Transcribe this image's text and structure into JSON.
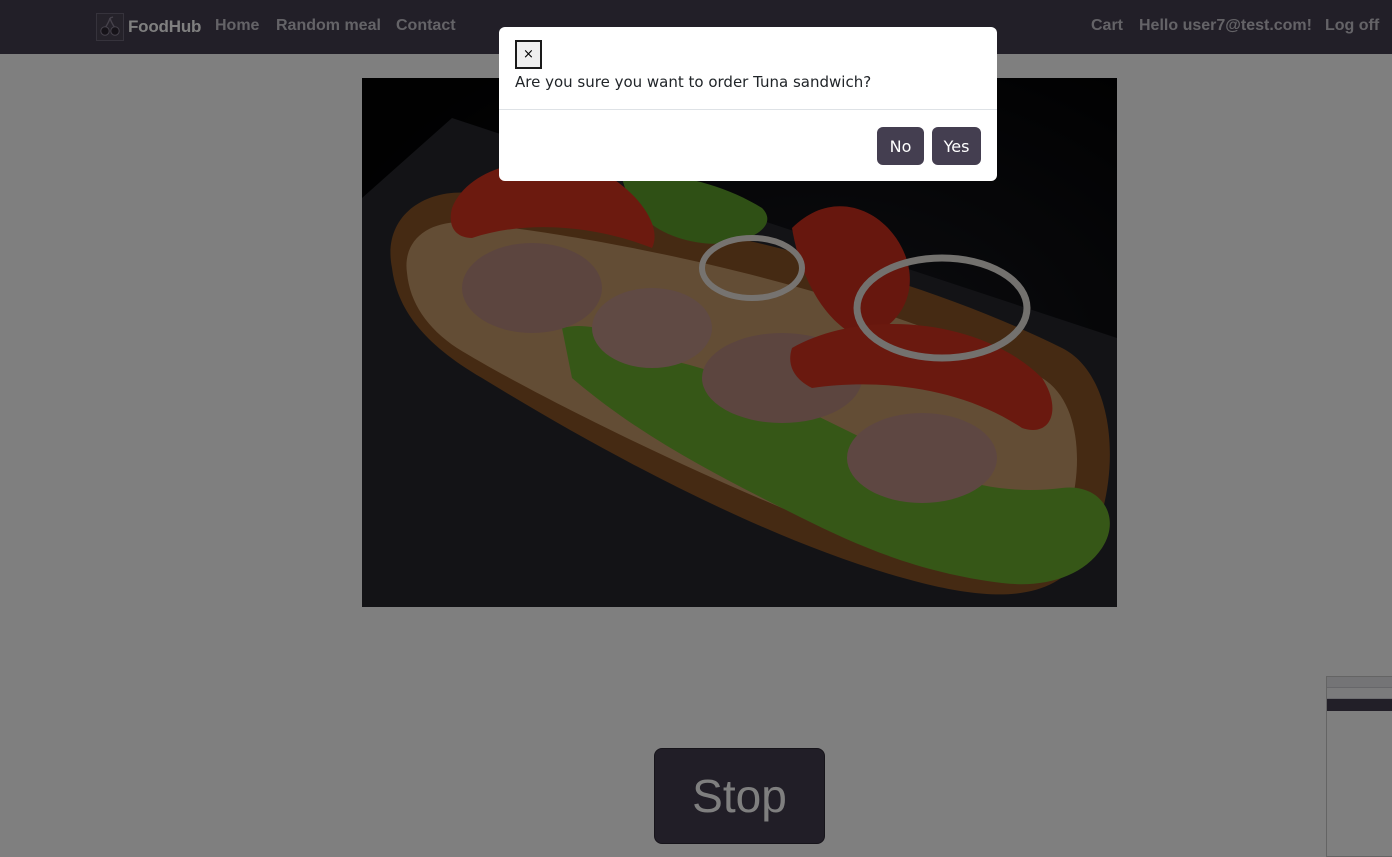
{
  "navbar": {
    "brand": "FoodHub",
    "links": [
      "Home",
      "Random meal",
      "Contact"
    ],
    "right_links": [
      "Cart",
      "Hello user7@test.com!",
      "Log off"
    ]
  },
  "main": {
    "image_alt": "Tuna sandwich",
    "stop_label": "Stop"
  },
  "modal": {
    "close_label": "×",
    "message": "Are you sure you want to order Tuna sandwich?",
    "no_label": "No",
    "yes_label": "Yes"
  },
  "colors": {
    "navbar": "#443e50",
    "button": "#443e50",
    "overlay": "rgba(0,0,0,0.5)"
  },
  "icons": {
    "brand_logo": "cherries-icon",
    "close": "close-icon"
  }
}
